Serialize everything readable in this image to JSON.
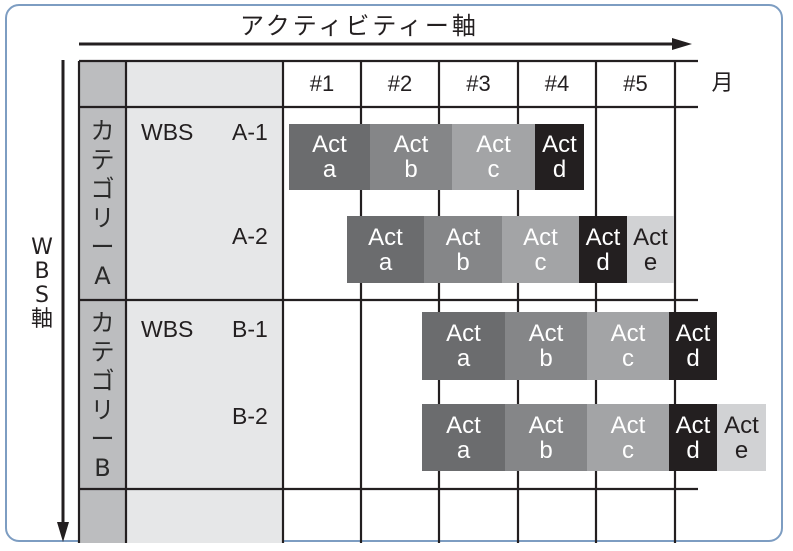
{
  "title": "アクティビティー軸",
  "wbs_axis_label": [
    "W",
    "B",
    "S",
    "軸"
  ],
  "month_label": "月",
  "columns": [
    "#1",
    "#2",
    "#3",
    "#4",
    "#5"
  ],
  "categories": [
    {
      "label": [
        "カ",
        "テ",
        "ゴ",
        "リ",
        "ー",
        "A"
      ],
      "wbs_label": "WBS",
      "items": [
        "A-1",
        "A-2"
      ]
    },
    {
      "label": [
        "カ",
        "テ",
        "ゴ",
        "リ",
        "ー",
        "B"
      ],
      "wbs_label": "WBS",
      "items": [
        "B-1",
        "B-2"
      ]
    }
  ],
  "activity_word": "Act",
  "colors": {
    "a": "#6b6c6e",
    "b": "#858688",
    "c": "#a3a4a6",
    "d": "#231f20",
    "e": "#d1d2d4",
    "frame": "#7d9dc2",
    "cat_col": "#bcbdbf",
    "wbs_col": "#e6e7e8"
  },
  "rows": [
    {
      "wbs": "A-1",
      "activities": [
        {
          "id": "a",
          "label": "Act a"
        },
        {
          "id": "b",
          "label": "Act b"
        },
        {
          "id": "c",
          "label": "Act c"
        },
        {
          "id": "d",
          "label": "Act d"
        }
      ]
    },
    {
      "wbs": "A-2",
      "activities": [
        {
          "id": "a",
          "label": "Act a"
        },
        {
          "id": "b",
          "label": "Act b"
        },
        {
          "id": "c",
          "label": "Act c"
        },
        {
          "id": "d",
          "label": "Act d"
        },
        {
          "id": "e",
          "label": "Act e"
        }
      ]
    },
    {
      "wbs": "B-1",
      "activities": [
        {
          "id": "a",
          "label": "Act a"
        },
        {
          "id": "b",
          "label": "Act b"
        },
        {
          "id": "c",
          "label": "Act c"
        },
        {
          "id": "d",
          "label": "Act d"
        }
      ]
    },
    {
      "wbs": "B-2",
      "activities": [
        {
          "id": "a",
          "label": "Act a"
        },
        {
          "id": "b",
          "label": "Act b"
        },
        {
          "id": "c",
          "label": "Act c"
        },
        {
          "id": "d",
          "label": "Act d"
        },
        {
          "id": "e",
          "label": "Act e"
        }
      ]
    }
  ]
}
